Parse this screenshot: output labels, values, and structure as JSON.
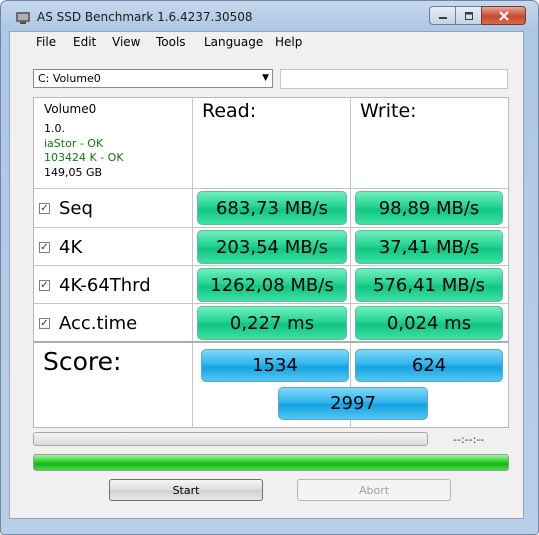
{
  "window": {
    "title": "AS SSD Benchmark 1.6.4237.30508"
  },
  "menu": [
    "File",
    "Edit",
    "View",
    "Tools",
    "Language",
    "Help"
  ],
  "drive": {
    "selected": "C: Volume0"
  },
  "info": {
    "name": "Volume0",
    "version": "1.0.",
    "driver": "iaStor - OK",
    "alignment": "103424 K - OK",
    "size": "149,05 GB"
  },
  "headers": {
    "read": "Read:",
    "write": "Write:"
  },
  "rows": [
    {
      "label": "Seq",
      "checked": true,
      "read": "683,73 MB/s",
      "write": "98,89 MB/s"
    },
    {
      "label": "4K",
      "checked": true,
      "read": "203,54 MB/s",
      "write": "37,41 MB/s"
    },
    {
      "label": "4K-64Thrd",
      "checked": true,
      "read": "1262,08 MB/s",
      "write": "576,41 MB/s"
    },
    {
      "label": "Acc.time",
      "checked": true,
      "read": "0,227 ms",
      "write": "0,024 ms"
    }
  ],
  "score": {
    "label": "Score:",
    "read": "1534",
    "write": "624",
    "total": "2997"
  },
  "timer": "--:--:--",
  "progress": {
    "test_fraction": 0.0,
    "overall_fraction": 1.0
  },
  "buttons": {
    "start": "Start",
    "abort": "Abort"
  },
  "colors": {
    "value_green": "#1fcf8f",
    "score_blue": "#22acea",
    "progress_green": "#22c722"
  }
}
